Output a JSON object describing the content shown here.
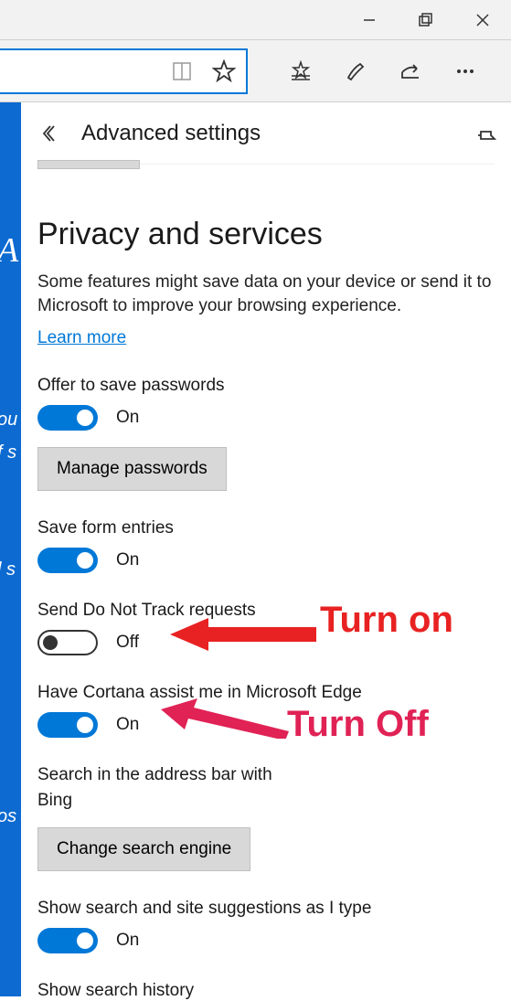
{
  "window": {
    "minimize_aria": "Minimize",
    "maximize_aria": "Restore",
    "close_aria": "Close"
  },
  "toolbar": {
    "reading_icon": "reading-list",
    "star_icon": "favorite-star",
    "add_fav_icon": "add-favorite",
    "notes_icon": "web-note",
    "share_icon": "share",
    "more_icon": "more"
  },
  "panel": {
    "title": "Advanced settings",
    "back_aria": "Back",
    "pin_aria": "Pin pane"
  },
  "section": {
    "heading": "Privacy and services",
    "description": "Some features might save data on your device or send it to Microsoft to improve your browsing experience.",
    "learn_more": "Learn more"
  },
  "settings": {
    "offer_pw_label": "Offer to save passwords",
    "offer_pw_state": "On",
    "manage_pw_btn": "Manage passwords",
    "save_forms_label": "Save form entries",
    "save_forms_state": "On",
    "dnt_label": "Send Do Not Track requests",
    "dnt_state": "Off",
    "cortana_label": "Have Cortana assist me in Microsoft Edge",
    "cortana_state": "On",
    "search_bar_label": "Search in the address bar with",
    "search_engine": "Bing",
    "change_engine_btn": "Change search engine",
    "suggestions_label": "Show search and site suggestions as I type",
    "suggestions_state": "On",
    "history_label": "Show search history"
  },
  "annotations": {
    "turn_on": "Turn on",
    "turn_off": "Turn Off"
  },
  "blue_strip": {
    "a": "A",
    "ou": "ou",
    "fs": "f s",
    "ls": "l s",
    "os": "os"
  }
}
